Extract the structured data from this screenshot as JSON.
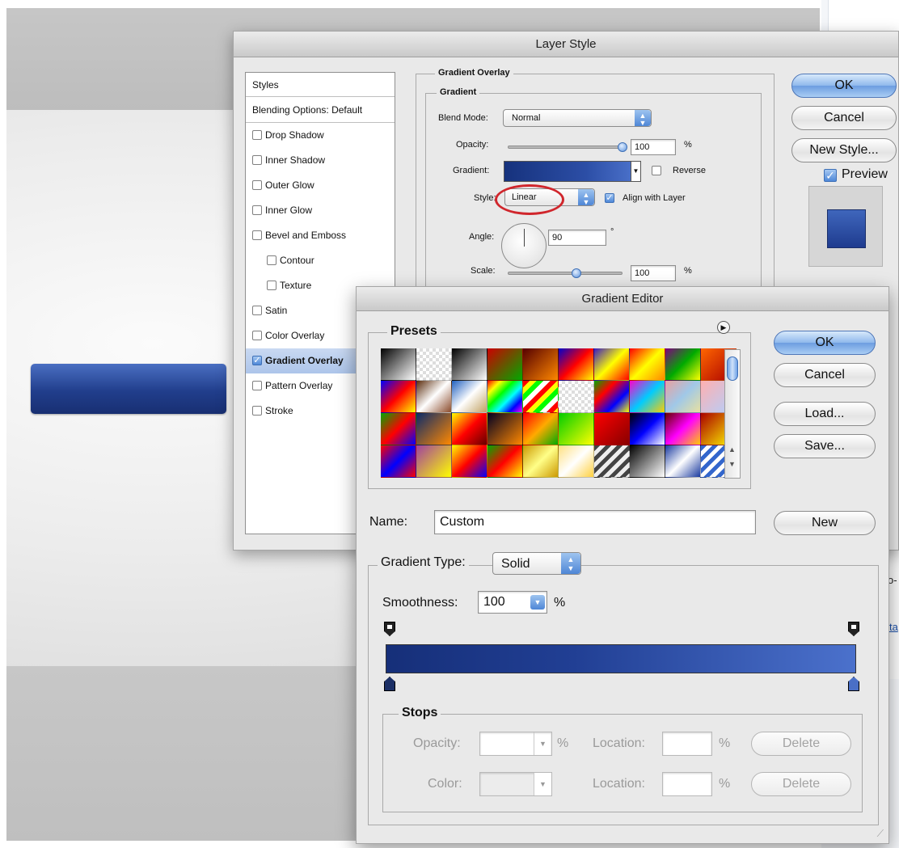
{
  "colors": {
    "accent_blue": "#4f88d8",
    "gradient_start": "#162f79",
    "gradient_end": "#4b71cc",
    "annotation_red": "#d0262c"
  },
  "background_clip": {
    "partial_text_1": "o-l",
    "partial_text_2": "ta"
  },
  "layer_style": {
    "title": "Layer Style",
    "styles_list": {
      "header": "Styles",
      "blending_options": "Blending Options: Default",
      "items": [
        {
          "label": "Drop Shadow",
          "checked": false,
          "indent": false
        },
        {
          "label": "Inner Shadow",
          "checked": false,
          "indent": false
        },
        {
          "label": "Outer Glow",
          "checked": false,
          "indent": false
        },
        {
          "label": "Inner Glow",
          "checked": false,
          "indent": false
        },
        {
          "label": "Bevel and Emboss",
          "checked": false,
          "indent": false
        },
        {
          "label": "Contour",
          "checked": false,
          "indent": true
        },
        {
          "label": "Texture",
          "checked": false,
          "indent": true
        },
        {
          "label": "Satin",
          "checked": false,
          "indent": false
        },
        {
          "label": "Color Overlay",
          "checked": false,
          "indent": false
        },
        {
          "label": "Gradient Overlay",
          "checked": true,
          "indent": false,
          "selected": true
        },
        {
          "label": "Pattern Overlay",
          "checked": false,
          "indent": false
        },
        {
          "label": "Stroke",
          "checked": false,
          "indent": false
        }
      ]
    },
    "gradient_overlay": {
      "section_title": "Gradient Overlay",
      "group_title": "Gradient",
      "blend_mode_label": "Blend Mode:",
      "blend_mode_value": "Normal",
      "opacity_label": "Opacity:",
      "opacity_value": "100",
      "opacity_level": 1.0,
      "percent": "%",
      "gradient_label": "Gradient:",
      "reverse_label": "Reverse",
      "reverse_checked": false,
      "style_label": "Style:",
      "style_value": "Linear",
      "align_label": "Align with Layer",
      "align_checked": true,
      "angle_label": "Angle:",
      "angle_value": "90",
      "degree": "°",
      "scale_label": "Scale:",
      "scale_value": "100",
      "scale_level": 0.6
    },
    "buttons": {
      "ok": "OK",
      "cancel": "Cancel",
      "new_style": "New Style..."
    },
    "preview_label": "Preview",
    "preview_checked": true
  },
  "gradient_editor": {
    "title": "Gradient Editor",
    "presets_label": "Presets",
    "presets_menu_icon": "circle-arrow-menu-icon",
    "buttons": {
      "ok": "OK",
      "cancel": "Cancel",
      "load": "Load...",
      "save": "Save...",
      "new": "New"
    },
    "name_label": "Name:",
    "name_value": "Custom",
    "gradient_type_label": "Gradient Type:",
    "gradient_type_value": "Solid",
    "smoothness_label": "Smoothness:",
    "smoothness_value": "100",
    "percent": "%",
    "stops": {
      "title": "Stops",
      "opacity_label": "Opacity:",
      "location_label": "Location:",
      "color_label": "Color:",
      "delete": "Delete",
      "percent": "%"
    }
  }
}
